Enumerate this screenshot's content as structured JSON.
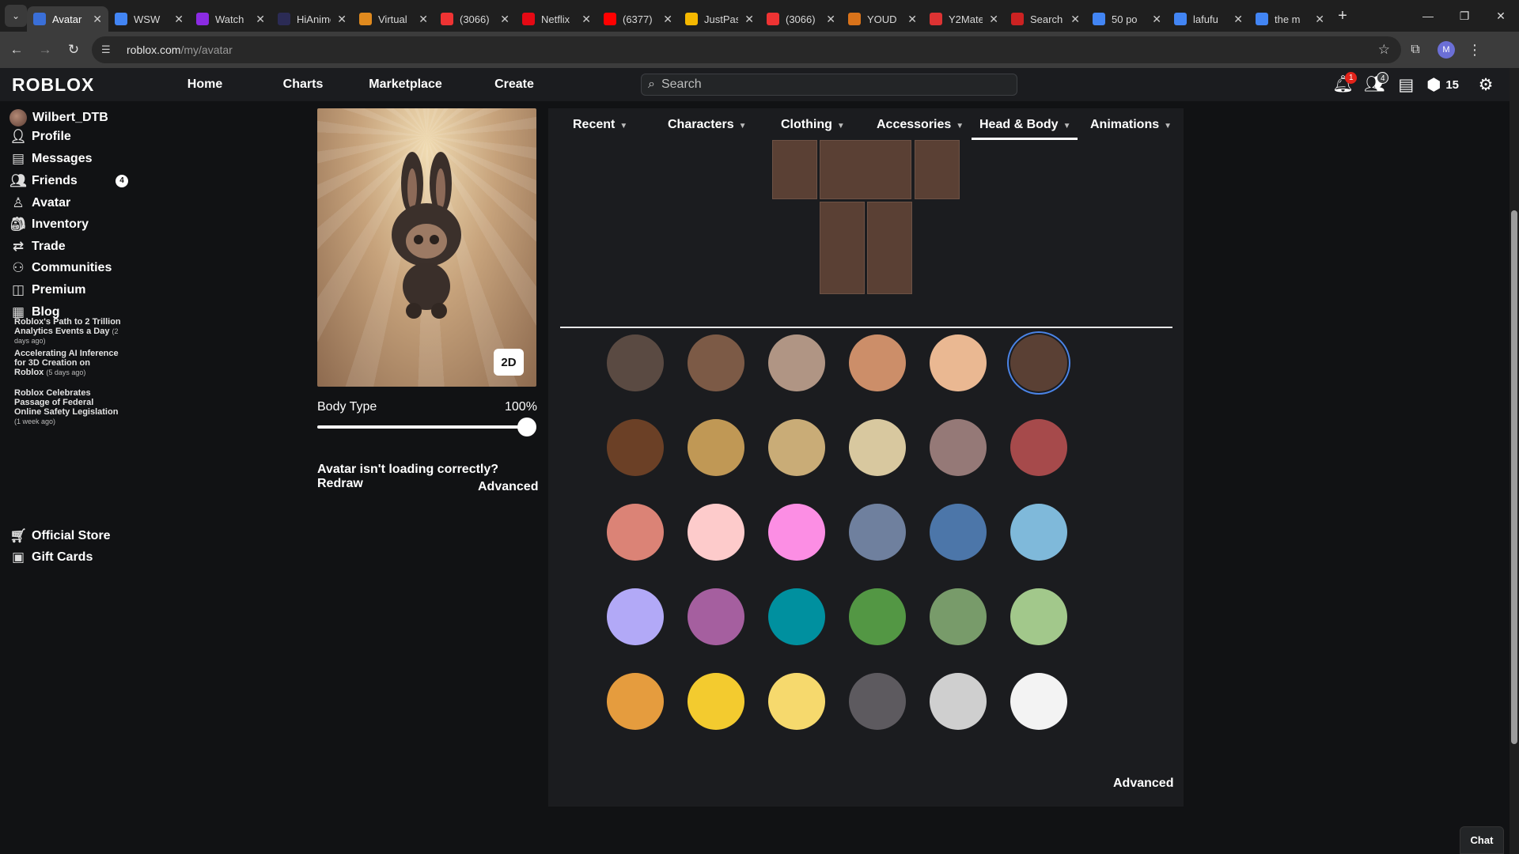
{
  "browser": {
    "tabs": [
      {
        "title": "Avatar",
        "fav": "roblox",
        "color": "#3a6fd8",
        "active": true
      },
      {
        "title": "WSW",
        "fav": "docs",
        "color": "#4285f4"
      },
      {
        "title": "Watch",
        "fav": "play",
        "color": "#8b2be2"
      },
      {
        "title": "HiAnime",
        "fav": "hi",
        "color": "#2b2b55"
      },
      {
        "title": "Virtual",
        "fav": "v",
        "color": "#e08a1e"
      },
      {
        "title": "(3066)",
        "fav": "sky",
        "color": "#e33"
      },
      {
        "title": "Netflix",
        "fav": "N",
        "color": "#e50914"
      },
      {
        "title": "(6377)",
        "fav": "yt",
        "color": "#ff0000"
      },
      {
        "title": "JustPaste",
        "fav": "JP",
        "color": "#f5b800"
      },
      {
        "title": "(3066)",
        "fav": "sky",
        "color": "#e33"
      },
      {
        "title": "YOUD",
        "fav": "o",
        "color": "#d9731a"
      },
      {
        "title": "Y2Mate",
        "fav": "Y2",
        "color": "#d33"
      },
      {
        "title": "Search",
        "fav": "s",
        "color": "#c22"
      },
      {
        "title": "50 po",
        "fav": "G",
        "color": "#4285f4"
      },
      {
        "title": "lafufu",
        "fav": "G",
        "color": "#4285f4"
      },
      {
        "title": "the m",
        "fav": "G",
        "color": "#4285f4"
      }
    ],
    "url_host": "roblox.com",
    "url_path": "/my/avatar",
    "profile_initial": "M"
  },
  "header": {
    "logo": "ROBLOX",
    "nav": [
      "Home",
      "Charts",
      "Marketplace",
      "Create"
    ],
    "search_placeholder": "Search",
    "notifications_badge": "1",
    "friends_badge": "4",
    "robux": "15"
  },
  "sidebar": {
    "username": "Wilbert_DTB",
    "items": [
      {
        "label": "Profile",
        "icon": "person-icon"
      },
      {
        "label": "Messages",
        "icon": "message-icon"
      },
      {
        "label": "Friends",
        "icon": "friends-icon",
        "count": "4"
      },
      {
        "label": "Avatar",
        "icon": "avatar-icon"
      },
      {
        "label": "Inventory",
        "icon": "inventory-icon"
      },
      {
        "label": "Trade",
        "icon": "trade-icon"
      },
      {
        "label": "Communities",
        "icon": "communities-icon"
      },
      {
        "label": "Premium",
        "icon": "premium-icon"
      },
      {
        "label": "Blog",
        "icon": "blog-icon"
      }
    ],
    "blog_posts": [
      {
        "title": "Roblox's Path to 2 Trillion Analytics Events a Day",
        "ago": "(2 days ago)"
      },
      {
        "title": "Accelerating AI Inference for 3D Creation on Roblox",
        "ago": "(5 days ago)"
      },
      {
        "title": "Roblox Celebrates Passage of Federal Online Safety Legislation",
        "ago": "(1 week ago)"
      }
    ],
    "bottom_items": [
      {
        "label": "Official Store",
        "icon": "store-icon"
      },
      {
        "label": "Gift Cards",
        "icon": "giftcard-icon"
      }
    ]
  },
  "preview": {
    "toggle_label": "2D",
    "body_type_label": "Body Type",
    "body_type_value": "100%",
    "body_type_fraction": 1.0,
    "redraw_text": "Avatar isn't loading correctly?",
    "redraw_link": "Redraw",
    "advanced_label": "Advanced"
  },
  "editor": {
    "tabs": [
      "Recent",
      "Characters",
      "Clothing",
      "Accessories",
      "Head & Body",
      "Animations"
    ],
    "active_tab": "Head & Body",
    "body_part_color": "#5a4034",
    "skin_colors": [
      [
        "#5a4a42",
        "#7c5a46",
        "#b09584",
        "#cc8e69",
        "#eab892",
        "#5a4034"
      ],
      [
        "#6b4026",
        "#c09855",
        "#c9ac77",
        "#d8c89f",
        "#957977",
        "#a64a4b"
      ],
      [
        "#db8376",
        "#fdcbcb",
        "#fc8ee4",
        "#6f809e",
        "#4c76a9",
        "#7fb9da"
      ],
      [
        "#b2a9f7",
        "#a55f9f",
        "#00909f",
        "#539744",
        "#789b6a",
        "#a2c88b"
      ],
      [
        "#e59c3e",
        "#f3cb2f",
        "#f6d96d",
        "#5d5a5f",
        "#cfcfcf",
        "#f3f3f3"
      ]
    ],
    "selected_color": "#5a4034",
    "advanced_label": "Advanced"
  },
  "chat_label": "Chat"
}
